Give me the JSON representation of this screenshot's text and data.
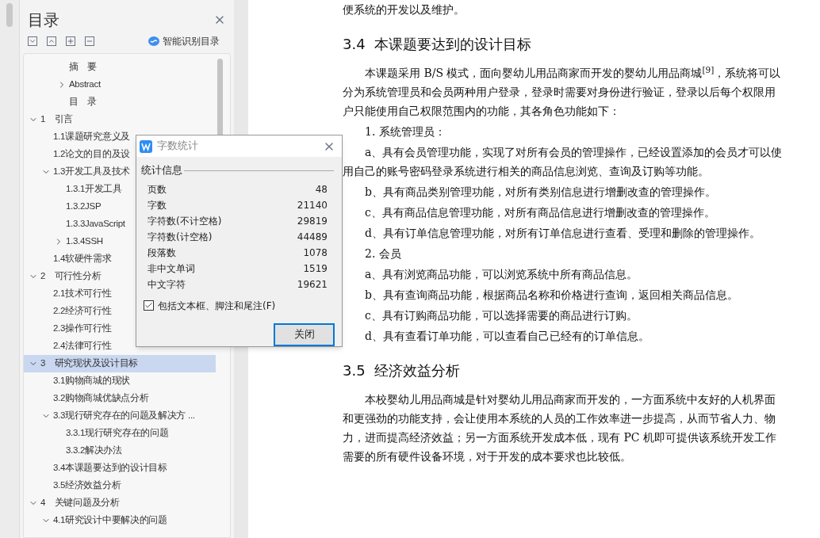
{
  "toc": {
    "title": "目录",
    "smart_label": "智能识别目录",
    "items": [
      {
        "label": "摘　要",
        "kind": "front"
      },
      {
        "label": "Abstract",
        "kind": "front",
        "expanded": false
      },
      {
        "label": "目　录",
        "kind": "front"
      },
      {
        "label": "1　引言",
        "kind": "chapter",
        "expanded": true,
        "selected": false,
        "children": [
          {
            "label": "1.1课题研究意义及",
            "selected": false
          },
          {
            "label": "1.2论文的目的及设",
            "selected": false
          },
          {
            "label": "1.3开发工具及技术",
            "expanded": true,
            "selected": false,
            "children": [
              {
                "label": "1.3.1开发工具",
                "selected": false
              },
              {
                "label": "1.3.2JSP",
                "selected": false
              },
              {
                "label": "1.3.3JavaScript",
                "selected": false
              },
              {
                "label": "1.3.4SSH",
                "expanded": false,
                "selected": false
              }
            ]
          },
          {
            "label": "1.4软硬件需求",
            "selected": false
          }
        ]
      },
      {
        "label": "2　可行性分析",
        "kind": "chapter",
        "expanded": true,
        "selected": false,
        "children": [
          {
            "label": "2.1技术可行性",
            "selected": false
          },
          {
            "label": "2.2经济可行性",
            "selected": false
          },
          {
            "label": "2.3操作可行性",
            "selected": false
          },
          {
            "label": "2.4法律可行性",
            "selected": false
          }
        ]
      },
      {
        "label": "3　研究现状及设计目标",
        "kind": "chapter",
        "expanded": true,
        "selected": true,
        "children": [
          {
            "label": "3.1购物商城的现状",
            "selected": false
          },
          {
            "label": "3.2购物商城优缺点分析",
            "selected": false
          },
          {
            "label": "3.3现行研究存在的问题及解决方 ...",
            "expanded": true,
            "selected": false,
            "children": [
              {
                "label": "3.3.1现行研究存在的问题",
                "selected": false
              },
              {
                "label": "3.3.2解决办法",
                "selected": false
              }
            ]
          },
          {
            "label": "3.4本课题要达到的设计目标",
            "selected": false
          },
          {
            "label": "3.5经济效益分析",
            "selected": false
          }
        ]
      },
      {
        "label": "4　关键问题及分析",
        "kind": "chapter",
        "expanded": true,
        "selected": false,
        "children": [
          {
            "label": "4.1研究设计中要解决的问题",
            "expanded": true,
            "selected": false
          }
        ]
      }
    ]
  },
  "document": [
    {
      "kind": "cont",
      "text": "便系统的开发以及维护。"
    },
    {
      "kind": "heading",
      "text": "3.4  本课题要达到的设计目标"
    },
    {
      "kind": "para",
      "text": "本课题采用 B/S 模式，面向婴幼儿用品商家而开发的婴幼儿用品商城$^{[9]}$，系统将可以分为系统管理员和会员两种用户登录，登录时需要对身份进行验证，登录以后每个权限用户只能使用自己权限范围内的功能，其各角色功能如下："
    },
    {
      "kind": "para",
      "text": "1. 系统管理员："
    },
    {
      "kind": "para",
      "text": "a、具有会员管理功能，实现了对所有会员的管理操作，已经设置添加的会员才可以使用自己的账号密码登录系统进行相关的商品信息浏览、查询及订购等功能。"
    },
    {
      "kind": "para",
      "text": "b、具有商品类别管理功能，对所有类别信息进行增删改查的管理操作。"
    },
    {
      "kind": "para",
      "text": "c、具有商品信息管理功能，对所有商品信息进行增删改查的管理操作。"
    },
    {
      "kind": "para",
      "text": "d、具有订单信息管理功能，对所有订单信息进行查看、受理和删除的管理操作。"
    },
    {
      "kind": "para",
      "text": "2. 会员"
    },
    {
      "kind": "para",
      "text": "a、具有浏览商品功能，可以浏览系统中所有商品信息。"
    },
    {
      "kind": "para",
      "text": "b、具有查询商品功能，根据商品名称和价格进行查询，返回相关商品信息。"
    },
    {
      "kind": "para",
      "text": "c、具有订购商品功能，可以选择需要的商品进行订购。"
    },
    {
      "kind": "para",
      "text": "d、具有查看订单功能，可以查看自己已经有的订单信息。"
    },
    {
      "kind": "heading",
      "text": "3.5  经济效益分析"
    },
    {
      "kind": "para",
      "text": "本校婴幼儿用品商城是针对婴幼儿用品商家而开发的，一方面系统中友好的人机界面和更强劲的功能支持，会让使用本系统的人员的工作效率进一步提高，从而节省人力、物力，进而提高经济效益；另一方面系统开发成本低，现有 PC 机即可提供该系统开发工作需要的所有硬件设备环境，对于开发的成本要求也比较低。"
    }
  ],
  "dialog": {
    "title": "字数统计",
    "group": "统计信息",
    "stats": [
      {
        "label": "页数",
        "value": "48"
      },
      {
        "label": "字数",
        "value": "21140"
      },
      {
        "label": "字符数(不计空格)",
        "value": "29819"
      },
      {
        "label": "字符数(计空格)",
        "value": "44489"
      },
      {
        "label": "段落数",
        "value": "1078"
      },
      {
        "label": "非中文单词",
        "value": "1519"
      },
      {
        "label": "中文字符",
        "value": "19621"
      }
    ],
    "checkbox": {
      "label": "包括文本框、脚注和尾注(F)",
      "checked": true
    },
    "button": "关闭"
  }
}
